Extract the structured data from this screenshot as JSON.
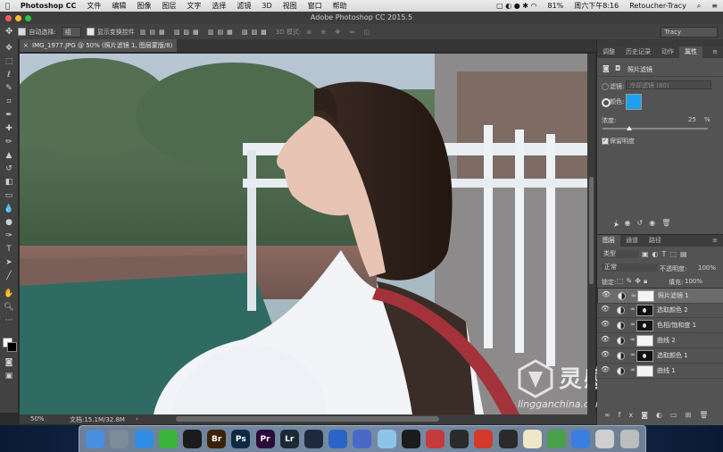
{
  "menubar": {
    "apple": "",
    "items": [
      "Photoshop CC",
      "文件",
      "编辑",
      "图像",
      "图层",
      "文字",
      "选择",
      "滤镜",
      "3D",
      "视图",
      "窗口",
      "帮助"
    ],
    "battery": "81%",
    "datetime": "周六下午8:16",
    "user": "Retoucher-Tracy"
  },
  "window": {
    "title": "Adobe Photoshop CC 2015.5"
  },
  "options": {
    "auto_select": "自动选择:",
    "auto_select_value": "组",
    "show_transform": "显示变换控件",
    "mode_3d": "3D 模式:",
    "workspace": "Tracy"
  },
  "document": {
    "tab_title": "IMG_1977.JPG @ 50% (照片滤镜 1, 图层蒙版/8) *"
  },
  "status": {
    "zoom": "50%",
    "doc_size": "文档:15.1M/32.8M"
  },
  "properties": {
    "tabs": [
      "调整",
      "历史记录",
      "动作",
      "属性"
    ],
    "active_tab": "属性",
    "header": "照片滤镜",
    "filter_label": "滤镜:",
    "filter_value": "冷却滤镜 (80)",
    "color_label": "颜色:",
    "color_swatch": "#1ea0f0",
    "density_label": "浓度:",
    "density_value": "25",
    "density_unit": "%",
    "density": 0.25,
    "preserve": "保留明度"
  },
  "layers_panel": {
    "tabs": [
      "图层",
      "通道",
      "路径"
    ],
    "kind": "类型",
    "blend_mode": "正常",
    "opacity_label": "不透明度:",
    "opacity": "100%",
    "lock_label": "锁定:",
    "fill_label": "填充:",
    "fill": "100%",
    "layers": [
      {
        "name": "照片滤镜 1",
        "mask": "white",
        "selected": true
      },
      {
        "name": "选取颜色 2",
        "mask": "black",
        "selected": false
      },
      {
        "name": "色相/饱和度 1",
        "mask": "black",
        "selected": false
      },
      {
        "name": "曲线 2",
        "mask": "white",
        "selected": false
      },
      {
        "name": "选取颜色 1",
        "mask": "black",
        "selected": false
      },
      {
        "name": "曲线 1",
        "mask": "white",
        "selected": false
      }
    ]
  },
  "watermark": {
    "title": "灵感中国",
    "url": "lingganchina.com"
  },
  "dock": {
    "apps": [
      {
        "label": "",
        "color": "#4a8fe0",
        "icon": "finder-icon"
      },
      {
        "label": "",
        "color": "#7e8c9a",
        "icon": "launchpad-icon"
      },
      {
        "label": "",
        "color": "#2f8de4",
        "icon": "safari-icon"
      },
      {
        "label": "",
        "color": "#3bb33b",
        "icon": "wechat-icon"
      },
      {
        "label": "",
        "color": "#1b1b1b",
        "icon": "qq-icon"
      },
      {
        "label": "Br",
        "color": "#3b2207",
        "icon": "bridge-icon"
      },
      {
        "label": "Ps",
        "color": "#0c2a43",
        "icon": "photoshop-icon"
      },
      {
        "label": "Pr",
        "color": "#2a0b3a",
        "icon": "premiere-icon"
      },
      {
        "label": "Lr",
        "color": "#1c2a36",
        "icon": "lightroom-icon"
      },
      {
        "label": "",
        "color": "#1f2a40",
        "icon": "cinema4d-icon"
      },
      {
        "label": "",
        "color": "#2b64c8",
        "icon": "baidu-netdisk-icon"
      },
      {
        "label": "",
        "color": "#4a68c8",
        "icon": "photo-app-icon"
      },
      {
        "label": "",
        "color": "#8ec4e8",
        "icon": "info-icon"
      },
      {
        "label": "",
        "color": "#1b1b1b",
        "icon": "davinci-icon"
      },
      {
        "label": "",
        "color": "#c53a3a",
        "icon": "record-icon"
      },
      {
        "label": "",
        "color": "#2a2a2a",
        "icon": "obs-icon"
      },
      {
        "label": "",
        "color": "#d33a2a",
        "icon": "netease-music-icon"
      },
      {
        "label": "",
        "color": "#2a2a2a",
        "icon": "quicktime-icon"
      },
      {
        "label": "",
        "color": "#f0e6c8",
        "icon": "notes-icon"
      },
      {
        "label": "",
        "color": "#4aa04a",
        "icon": "numbers-icon"
      },
      {
        "label": "",
        "color": "#3a7ee0",
        "icon": "keynote-icon"
      },
      {
        "label": "",
        "color": "#cfcfcf",
        "icon": "screen-icon"
      },
      {
        "label": "",
        "color": "#bdbdbd",
        "icon": "trash-icon"
      }
    ]
  }
}
